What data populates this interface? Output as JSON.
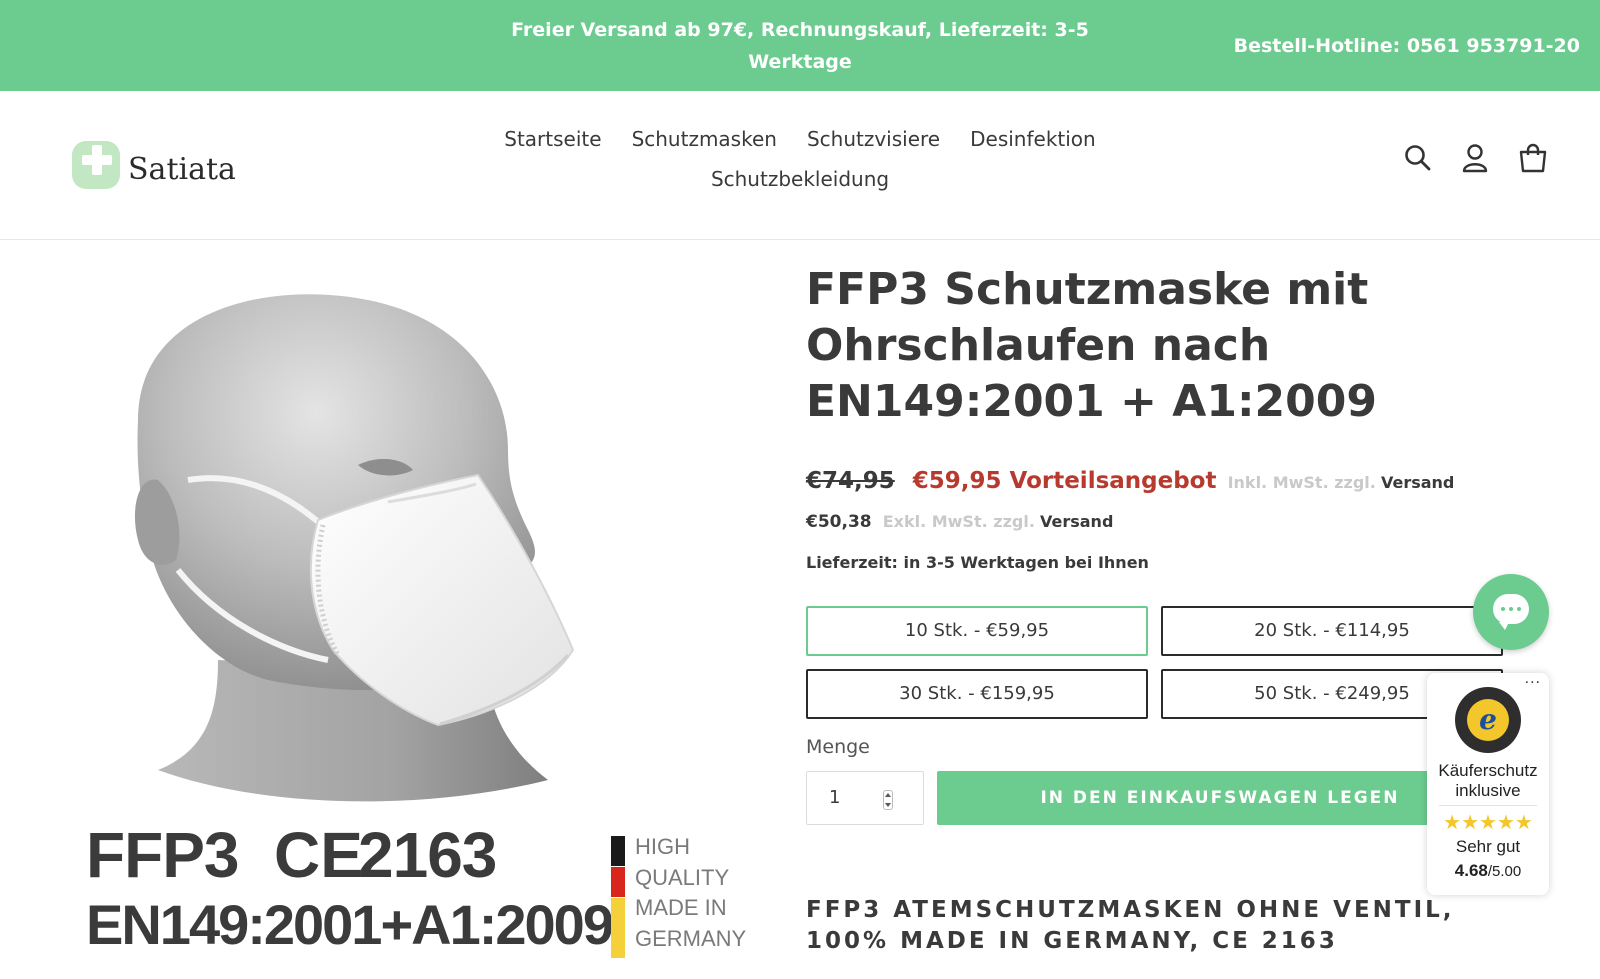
{
  "announcement": {
    "text": "Freier Versand ab 97€, Rechnungskauf, Lieferzeit: 3-5 Werktage",
    "hotline": "Bestell-Hotline: 0561 953791-20"
  },
  "header": {
    "logo_text": "Satiata",
    "nav": [
      "Startseite",
      "Schutzmasken",
      "Schutzvisiere",
      "Desinfektion",
      "Schutzbekleidung"
    ],
    "icons": [
      "search-icon",
      "account-icon",
      "cart-icon"
    ]
  },
  "gallery": {
    "label_ffp3": "FFP3",
    "label_ce": "CE",
    "label_number": "2163",
    "label_standard": "EN149:2001+A1:2009",
    "germany_lines": [
      "HIGH",
      "QUALITY",
      "MADE IN",
      "GERMANY"
    ],
    "flag_colors": [
      "#1a1a1a",
      "#d8261c",
      "#f4d03a",
      "#f4d03a"
    ]
  },
  "product": {
    "title": "FFP3 Schutzmaske mit Ohrschlaufen nach EN149:2001 + A1:2009",
    "price_old": "€74,95",
    "price_new": "€59,95 Vorteilsangebot",
    "tax_gross_muted": "Inkl. MwSt. zzgl.",
    "tax_gross_strong": "Versand",
    "price_net": "€50,38",
    "tax_net_muted": "Exkl. MwSt. zzgl.",
    "tax_net_strong": "Versand",
    "delivery": "Lieferzeit: in 3-5 Werktagen bei Ihnen",
    "variants": [
      {
        "label": "10 Stk. - €59,95",
        "selected": true
      },
      {
        "label": "20 Stk. - €114,95",
        "selected": false
      },
      {
        "label": "30 Stk. - €159,95",
        "selected": false
      },
      {
        "label": "50 Stk. - €249,95",
        "selected": false
      }
    ],
    "quantity_label": "Menge",
    "quantity_value": "1",
    "add_to_cart": "IN DEN EINKAUFSWAGEN LEGEN",
    "description_heading": "FFP3 ATEMSCHUTZMASKEN OHNE VENTIL, 100% MADE IN GERMANY, CE 2163"
  },
  "trusted_shops": {
    "more": "···",
    "title": "Käuferschutz inklusive",
    "stars": "★★★★★",
    "rating_text": "Sehr gut",
    "score": "4.68",
    "score_max": "/5.00"
  },
  "colors": {
    "accent": "#6ccb8f",
    "sale_price": "#b83a2e",
    "text": "#3a3a3a"
  }
}
